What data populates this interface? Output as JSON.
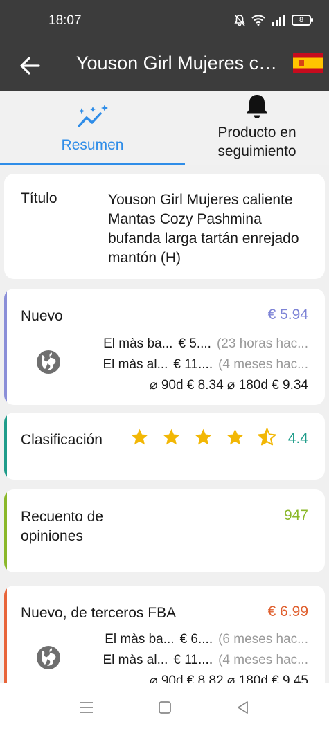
{
  "status": {
    "time": "18:07",
    "battery": "8"
  },
  "header": {
    "title": "Youson Girl Mujeres ca..."
  },
  "tabs": [
    {
      "label": "Resumen"
    },
    {
      "label": "Producto en seguimiento"
    }
  ],
  "summary": {
    "title_label": "Título",
    "title_value": "Youson Girl Mujeres caliente Mantas Cozy Pashmina bufanda larga tartán enrejado mantón (H)"
  },
  "new_price": {
    "label": "Nuevo",
    "value": "€ 5.94",
    "low_label": "El màs ba...",
    "low_price": "€ 5....",
    "low_when": "(23 horas hac...",
    "high_label": "El màs al...",
    "high_price": "€ 11....",
    "high_when": "(4 meses hac...",
    "avg": "⌀ 90d € 8.34 ⌀ 180d € 9.34",
    "accent": "#8b8fd8",
    "value_color": "#7d83d6"
  },
  "rating": {
    "label": "Clasificación",
    "value": "4.4",
    "stars": 4.4,
    "star_color": "#f2b705",
    "accent": "#1f9c8a"
  },
  "reviews": {
    "label": "Recuento de opiniones",
    "value": "947",
    "accent": "#8bb82a"
  },
  "fba": {
    "label": "Nuevo, de terceros FBA",
    "value": "€ 6.99",
    "low_label": "El màs ba...",
    "low_price": "€ 6....",
    "low_when": "(6 meses hac...",
    "high_label": "El màs al...",
    "high_price": "€ 11....",
    "high_when": "(4 meses hac...",
    "avg": "⌀ 90d € 8.82 ⌀ 180d € 9.45",
    "accent": "#e8653a",
    "value_color": "#e0602f"
  }
}
